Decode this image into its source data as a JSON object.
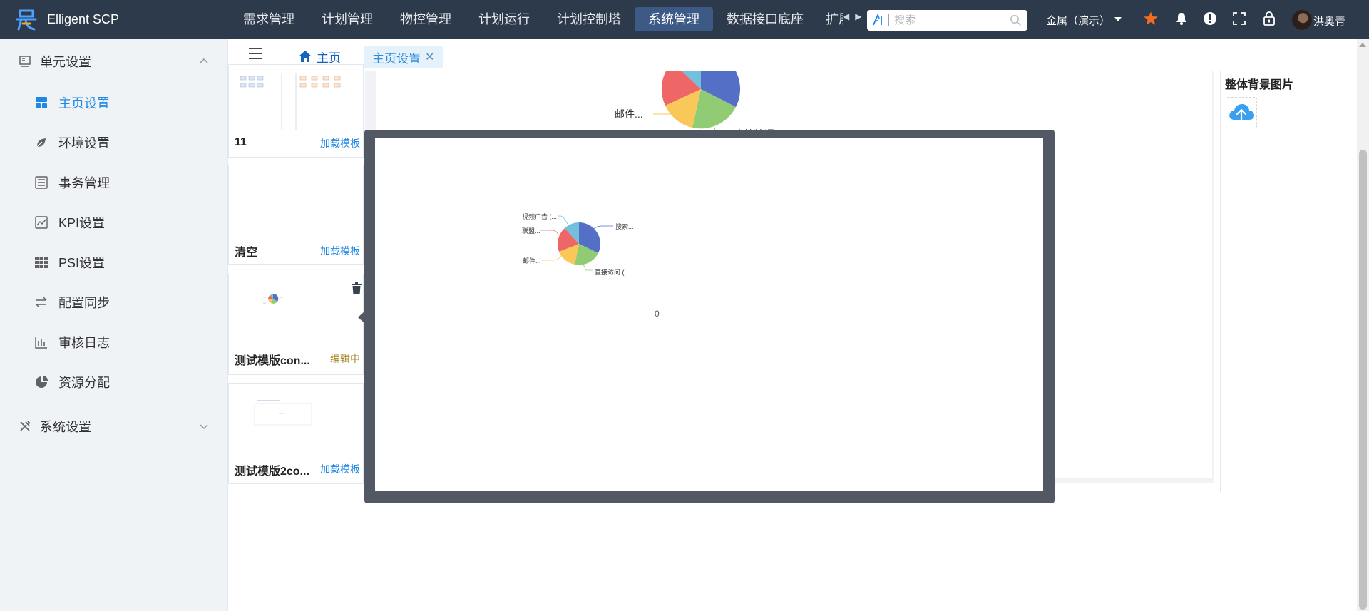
{
  "app": {
    "title": "Elligent SCP"
  },
  "nav": {
    "items": [
      "需求管理",
      "计划管理",
      "物控管理",
      "计划运行",
      "计划控制塔",
      "系统管理",
      "数据接口底座"
    ],
    "active_index": 5,
    "overflow_item": "扩展"
  },
  "search": {
    "placeholder": "搜索"
  },
  "header": {
    "tenant": "金属（演示）",
    "username": "洪奥青"
  },
  "colors": {
    "accent": "#1e88e5",
    "topbar": "#2d3a4b",
    "nav_active": "#3d5a87",
    "star": "#f26b21"
  },
  "sidebar": {
    "group1": "单元设置",
    "items": [
      "主页设置",
      "环境设置",
      "事务管理",
      "KPI设置",
      "PSI设置",
      "配置同步",
      "审核日志",
      "资源分配"
    ],
    "active_index": 0,
    "group2": "系统设置"
  },
  "tabs": {
    "home": "主页",
    "active": "主页设置"
  },
  "templates": [
    {
      "name": "11",
      "action": "加载模板"
    },
    {
      "name": "清空",
      "action": "加载模板"
    },
    {
      "name": "测试模版con...",
      "action": "编辑中"
    },
    {
      "name": "测试模版2co...",
      "action": "加载模板"
    }
  ],
  "right_panel": {
    "title": "整体背景图片"
  },
  "canvas": {
    "labels": {
      "mail": "邮件...",
      "direct": "直接访问 (..."
    }
  },
  "preview": {
    "labels": {
      "video": "视频广告 (...",
      "union": "联盟...",
      "mail": "邮件...",
      "search": "搜索...",
      "direct": "直接访问 (..."
    },
    "count": "0"
  }
}
